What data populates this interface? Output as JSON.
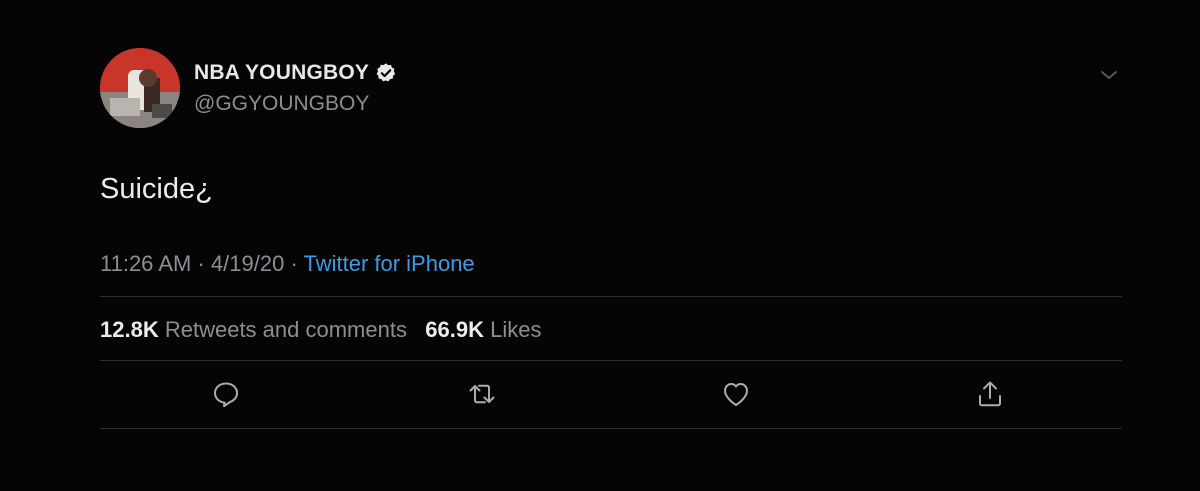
{
  "user": {
    "display_name": "NBA YOUNGBOY",
    "handle": "@GGYOUNGBOY",
    "verified_icon": "verified-badge-icon"
  },
  "tweet": {
    "text": "Suicide¿",
    "time": "11:26 AM",
    "date": "4/19/20",
    "separator": "·",
    "source": "Twitter for iPhone"
  },
  "stats": {
    "retweets_count": "12.8K",
    "retweets_label": "Retweets and comments",
    "likes_count": "66.9K",
    "likes_label": "Likes"
  },
  "actions": {
    "reply_icon": "reply-icon",
    "retweet_icon": "retweet-icon",
    "like_icon": "heart-icon",
    "share_icon": "share-icon"
  },
  "colors": {
    "background": "#050505",
    "text_primary": "#ececec",
    "text_secondary": "#8b8f95",
    "link": "#3f9ae4",
    "divider": "#2a2d31"
  }
}
